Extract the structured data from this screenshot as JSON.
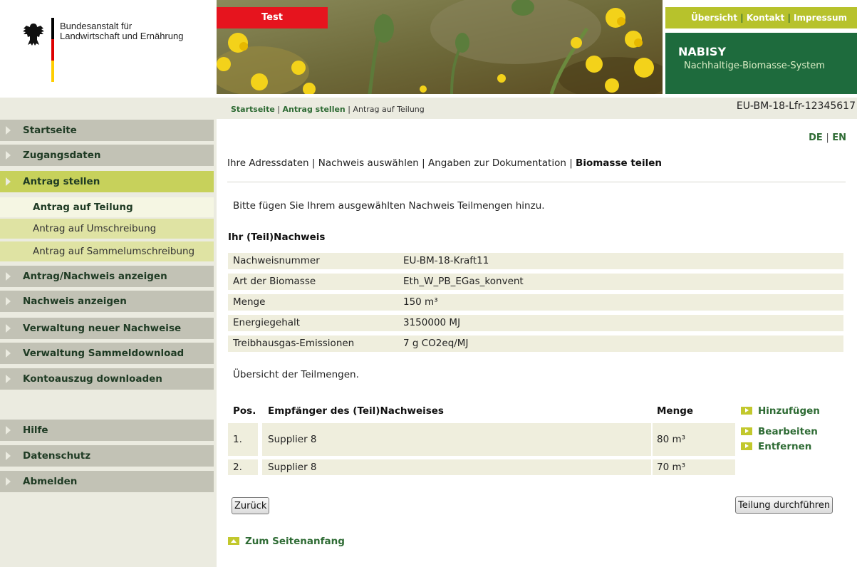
{
  "header": {
    "org_line1": "Bundesanstalt für",
    "org_line2": "Landwirtschaft und Ernährung",
    "test_label": "Test",
    "top_links": [
      "Übersicht",
      "Kontakt",
      "Impressum"
    ],
    "brand_title": "NABISY",
    "brand_subtitle": "Nachhaltige-Biomasse-System"
  },
  "breadcrumb": {
    "items": [
      "Startseite",
      "Antrag stellen"
    ],
    "current": "Antrag auf Teilung",
    "account_id": "EU-BM-18-Lfr-12345617"
  },
  "sidebar": {
    "items": [
      "Startseite",
      "Zugangsdaten",
      "Antrag stellen"
    ],
    "sub_items": [
      "Antrag auf Teilung",
      "Antrag auf Umschreibung",
      "Antrag auf Sammelumschreibung"
    ],
    "items_after": [
      "Antrag/Nachweis anzeigen",
      "Nachweis anzeigen",
      "Verwaltung neuer Nachweise",
      "Verwaltung Sammeldownload",
      "Kontoauszug downloaden"
    ],
    "bottom_items": [
      "Hilfe",
      "Datenschutz",
      "Abmelden"
    ]
  },
  "lang": {
    "de": "DE",
    "en": "EN"
  },
  "steps": [
    "Ihre Adressdaten",
    "Nachweis auswählen",
    "Angaben zur Dokumentation"
  ],
  "steps_current": "Biomasse teilen",
  "intro": "Bitte fügen Sie Ihrem ausgewählten Nachweis Teilmengen hinzu.",
  "section_title": "Ihr (Teil)Nachweis",
  "details": [
    {
      "label": "Nachweisnummer",
      "value": "EU-BM-18-Kraft11"
    },
    {
      "label": "Art der Biomasse",
      "value": "Eth_W_PB_EGas_konvent"
    },
    {
      "label": "Menge",
      "value": "150 m³"
    },
    {
      "label": "Energiegehalt",
      "value": "3150000 MJ"
    },
    {
      "label": "Treibhausgas-Emissionen",
      "value": "7 g CO2eq/MJ"
    }
  ],
  "overview_label": "Übersicht der Teilmengen.",
  "table": {
    "headers": {
      "pos": "Pos.",
      "recipient": "Empfänger des (Teil)Nachweises",
      "amount": "Menge"
    },
    "rows": [
      {
        "pos": "1.",
        "recipient": "Supplier 8",
        "amount": "80 m³"
      },
      {
        "pos": "2.",
        "recipient": "Supplier 8",
        "amount": "70 m³"
      }
    ]
  },
  "actions": {
    "add": "Hinzufügen",
    "edit": "Bearbeiten",
    "remove": "Entfernen"
  },
  "buttons": {
    "back": "Zurück",
    "submit": "Teilung durchführen"
  },
  "to_top": "Zum Seitenanfang",
  "colors": {
    "accent_green": "#2e6b34",
    "brand_dark_green": "#1e6b3d",
    "lime": "#b7c22c",
    "test_red": "#e6141e",
    "nav_gray": "#c2c2b5",
    "nav_active": "#c7d15b"
  },
  "icons": {
    "eagle": "federal-eagle-icon",
    "nav": "triangle-right-icon",
    "action": "arrow-right-icon",
    "to_top": "arrow-up-icon"
  }
}
